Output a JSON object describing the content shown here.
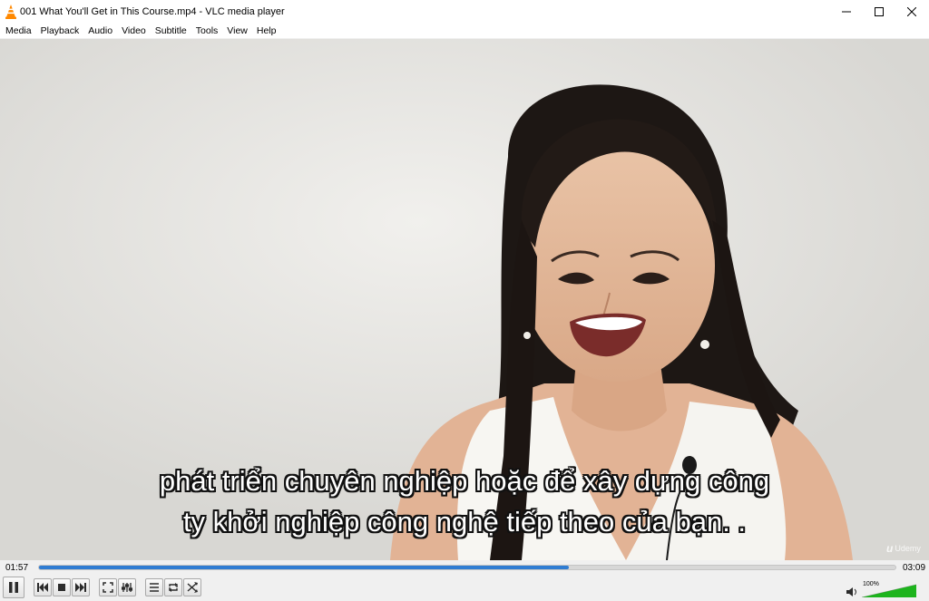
{
  "window": {
    "title": "001 What You'll Get in This Course.mp4 - VLC media player",
    "icon": "vlc-cone-icon",
    "controls": [
      "minimize-icon",
      "maximize-icon",
      "close-icon"
    ]
  },
  "menu": {
    "items": [
      "Media",
      "Playback",
      "Audio",
      "Video",
      "Subtitle",
      "Tools",
      "View",
      "Help"
    ]
  },
  "video": {
    "subtitle_line1": "phát triển chuyên nghiệp hoặc để xây dựng công",
    "subtitle_line2": "ty khởi nghiệp công nghệ tiếp theo của bạn. .",
    "watermark": "Udemy"
  },
  "playback": {
    "elapsed": "01:57",
    "total": "03:09",
    "progress_fraction": 0.619
  },
  "controls": {
    "buttons": [
      "pause-icon",
      "previous-icon",
      "stop-icon",
      "next-icon",
      "fullscreen-icon",
      "extended-settings-icon",
      "playlist-icon",
      "loop-icon",
      "shuffle-icon"
    ]
  },
  "volume": {
    "label": "100%",
    "level_fraction": 1.0,
    "accent": "#1db41d"
  },
  "colors": {
    "seek_fill": "#2f7cd2",
    "vlc_orange": "#ff8800"
  }
}
